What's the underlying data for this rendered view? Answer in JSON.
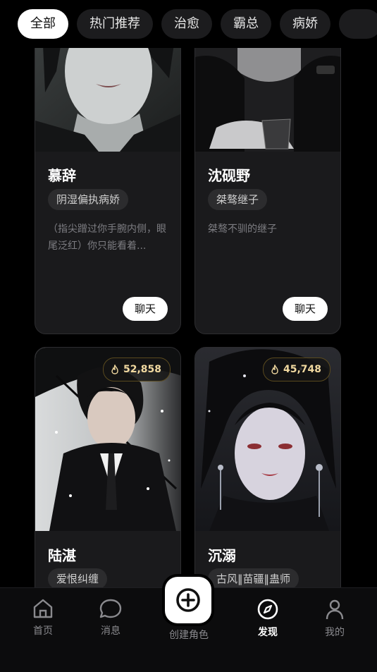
{
  "tabs": [
    {
      "label": "全部",
      "active": true
    },
    {
      "label": "热门推荐",
      "active": false
    },
    {
      "label": "治愈",
      "active": false
    },
    {
      "label": "霸总",
      "active": false
    },
    {
      "label": "病娇",
      "active": false
    },
    {
      "label": "",
      "active": false
    }
  ],
  "cards": [
    {
      "name": "慕辞",
      "tag": "阴湿偏执病娇",
      "desc": "（指尖蹭过你手腕内侧，眼尾泛红）你只能看着...",
      "chat": "聊天"
    },
    {
      "name": "沈砚野",
      "tag": "桀骜继子",
      "desc": "桀骜不驯的继子",
      "chat": "聊天"
    },
    {
      "name": "陆湛",
      "tag": "爱恨纠缠",
      "heat": "52,858"
    },
    {
      "name": "沉溺",
      "tag": "古风‖苗疆‖蛊师",
      "heat": "45,748"
    }
  ],
  "nav": {
    "home": "首页",
    "messages": "消息",
    "create": "创建角色",
    "discover": "发现",
    "mine": "我的"
  }
}
